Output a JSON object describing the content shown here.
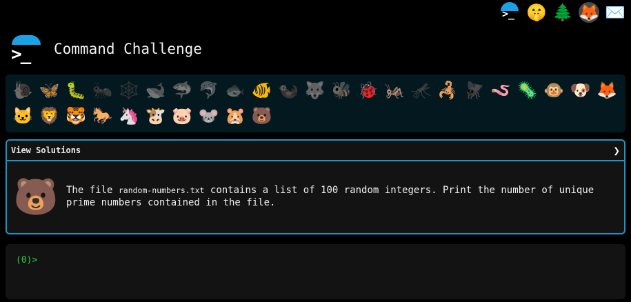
{
  "topbar": {
    "terminal_glyph": ">_",
    "icons": [
      {
        "name": "shush-face-icon",
        "glyph": "🤫"
      },
      {
        "name": "tree-icon",
        "glyph": "🌲"
      },
      {
        "name": "gitlab-icon",
        "glyph": "🦊"
      },
      {
        "name": "envelope-icon",
        "glyph": "✉️"
      }
    ]
  },
  "header": {
    "logo_glyph": ">_",
    "title": "Command Challenge"
  },
  "animals": [
    {
      "name": "snail",
      "glyph": "🐌",
      "dim": true
    },
    {
      "name": "butterfly",
      "glyph": "🦋",
      "dim": false
    },
    {
      "name": "caterpillar",
      "glyph": "🐛",
      "dim": false
    },
    {
      "name": "ant",
      "glyph": "🐜",
      "dim": true
    },
    {
      "name": "spider-web",
      "glyph": "🕸️",
      "dim": true
    },
    {
      "name": "whale",
      "glyph": "🐋",
      "dim": true
    },
    {
      "name": "shark",
      "glyph": "🦈",
      "dim": true
    },
    {
      "name": "dolphin",
      "glyph": "🐬",
      "dim": true
    },
    {
      "name": "fish",
      "glyph": "🐟",
      "dim": true
    },
    {
      "name": "tropical-fish",
      "glyph": "🐠",
      "dim": false
    },
    {
      "name": "otter",
      "glyph": "🦦",
      "dim": true
    },
    {
      "name": "wolf",
      "glyph": "🐺",
      "dim": true
    },
    {
      "name": "bee",
      "glyph": "🐝",
      "dim": true
    },
    {
      "name": "ladybug",
      "glyph": "🐞",
      "dim": false
    },
    {
      "name": "cricket",
      "glyph": "🦗",
      "dim": false
    },
    {
      "name": "mosquito",
      "glyph": "🦟",
      "dim": true
    },
    {
      "name": "scorpion",
      "glyph": "🦂",
      "dim": false
    },
    {
      "name": "fly",
      "glyph": "🪰",
      "dim": true
    },
    {
      "name": "worm",
      "glyph": "🪱",
      "dim": false
    },
    {
      "name": "microbe",
      "glyph": "🦠",
      "dim": false
    },
    {
      "name": "monkey",
      "glyph": "🐵",
      "dim": false
    },
    {
      "name": "dog",
      "glyph": "🐶",
      "dim": false
    },
    {
      "name": "fox",
      "glyph": "🦊",
      "dim": false
    },
    {
      "name": "cat",
      "glyph": "🐱",
      "dim": false
    },
    {
      "name": "lion",
      "glyph": "🦁",
      "dim": false
    },
    {
      "name": "tiger",
      "glyph": "🐯",
      "dim": false
    },
    {
      "name": "horse",
      "glyph": "🐎",
      "dim": false
    },
    {
      "name": "unicorn",
      "glyph": "🦄",
      "dim": false
    },
    {
      "name": "cow",
      "glyph": "🐮",
      "dim": false
    },
    {
      "name": "pig",
      "glyph": "🐷",
      "dim": false
    },
    {
      "name": "mouse",
      "glyph": "🐭",
      "dim": false
    },
    {
      "name": "hamster",
      "glyph": "🐹",
      "dim": false
    },
    {
      "name": "bear",
      "glyph": "🐻",
      "dim": false
    }
  ],
  "solutions": {
    "label": "View Solutions",
    "chevron": "❯",
    "bear_glyph": "🐻",
    "desc_before": "The file ",
    "file_name": "random-numbers.txt",
    "desc_after": " contains a list of 100 random integers. Print the number of unique prime numbers contained in the file."
  },
  "terminal": {
    "prompt": "(0)>"
  }
}
